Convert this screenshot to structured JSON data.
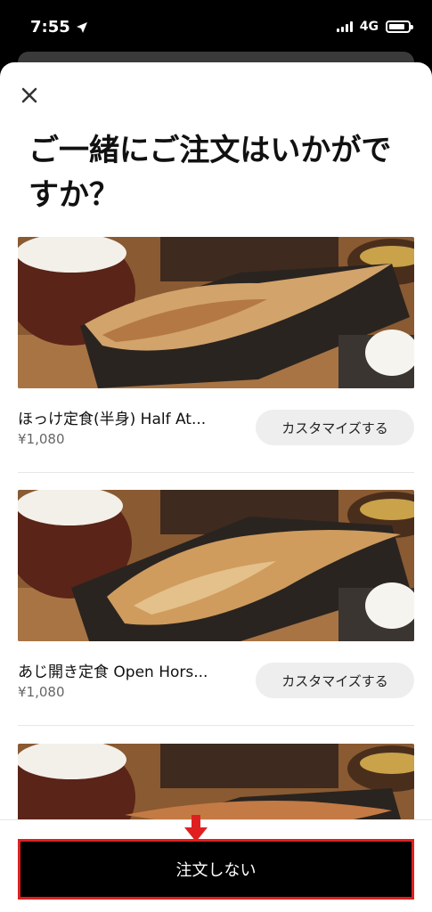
{
  "status": {
    "time": "7:55",
    "network": "4G"
  },
  "sheet": {
    "title": "ご一緒にご注文はいかがですか？",
    "items": [
      {
        "name": "ほっけ定食(半身) Half At...",
        "price": "¥1,080",
        "button": "カスタマイズする"
      },
      {
        "name": "あじ開き定食 Open Hors...",
        "price": "¥1,080",
        "button": "カスタマイズする"
      }
    ]
  },
  "footer": {
    "no_order_label": "注文しない"
  },
  "colors": {
    "accent": "#e02020",
    "button_bg": "#000000"
  },
  "icons": {
    "close": "close-icon",
    "location": "location-arrow-icon",
    "arrow": "arrow-down-icon"
  }
}
